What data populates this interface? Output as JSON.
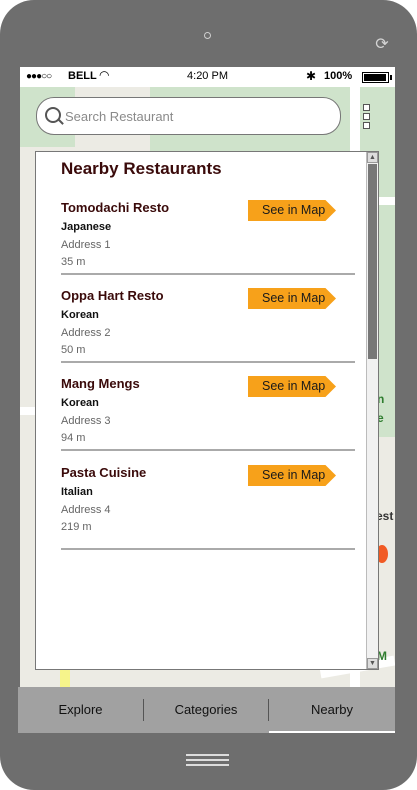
{
  "status_bar": {
    "signal": "●●●○○",
    "carrier": "BELL",
    "time": "4:20 PM",
    "bluetooth": "✱",
    "battery": "100%"
  },
  "search": {
    "placeholder": "Search Restaurant"
  },
  "map": {
    "labels": [
      "n",
      "e",
      "est",
      "M"
    ]
  },
  "panel": {
    "title": "Nearby Restaurants",
    "restaurants": [
      {
        "name": "Tomodachi Resto",
        "category": "Japanese",
        "address": "Address 1",
        "distance": "35 m",
        "button": "See in Map"
      },
      {
        "name": "Oppa Hart Resto",
        "category": "Korean",
        "address": "Address 2",
        "distance": "50 m",
        "button": "See in Map"
      },
      {
        "name": "Mang Mengs",
        "category": "Korean",
        "address": "Address 3",
        "distance": "94 m",
        "button": "See in Map"
      },
      {
        "name": "Pasta Cuisine",
        "category": "Italian",
        "address": "Address 4",
        "distance": "219 m",
        "button": "See in Map"
      }
    ]
  },
  "tabs": [
    {
      "label": "Explore"
    },
    {
      "label": "Categories"
    },
    {
      "label": "Nearby",
      "active": true
    }
  ]
}
